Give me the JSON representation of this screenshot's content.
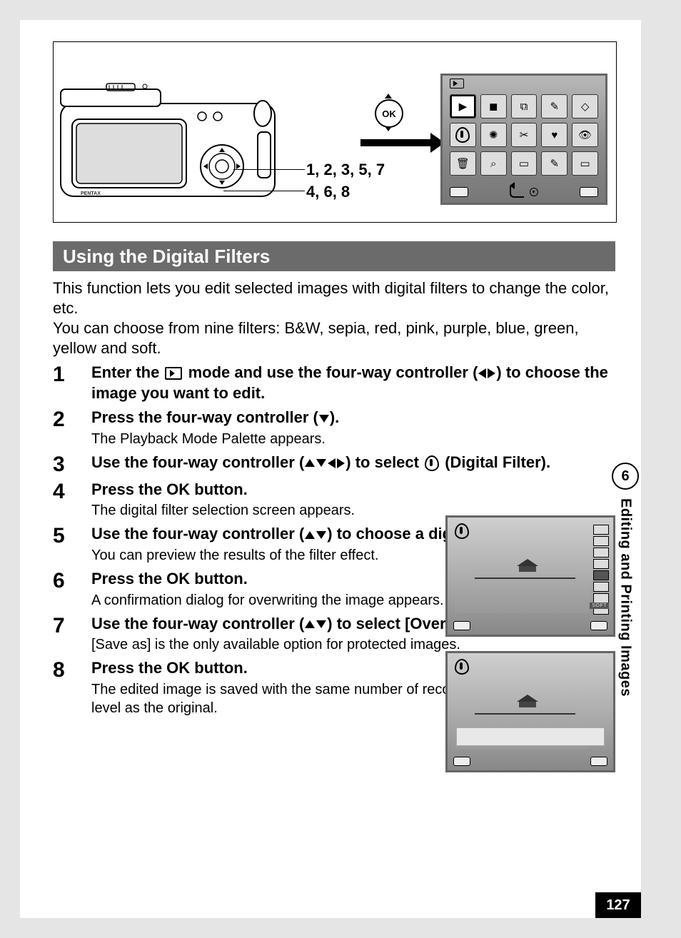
{
  "side": {
    "chapter": "6",
    "label": "Editing and Printing Images"
  },
  "page_number": "127",
  "figure": {
    "ok": "OK",
    "labels_line1": "1, 2, 3, 5, 7",
    "labels_line2": "4, 6, 8"
  },
  "section_title": "Using the Digital Filters",
  "intro_p1": "This function lets you edit selected images with digital filters to change the color, etc.",
  "intro_p2": "You can choose from nine filters: B&W, sepia, red, pink, purple, blue, green, yellow and soft.",
  "steps": {
    "s1": {
      "n": "1",
      "t1": "Enter the ",
      "t2": " mode and use the four-way controller (",
      "t3": ") to choose the image you want to edit."
    },
    "s2": {
      "n": "2",
      "title_a": "Press the four-way controller (",
      "title_b": ").",
      "desc": "The Playback Mode Palette appears."
    },
    "s3": {
      "n": "3",
      "title_a": "Use the four-way controller (",
      "title_b": ") to select ",
      "title_c": " (Digital Filter)."
    },
    "s4": {
      "n": "4",
      "title_a": "Press the ",
      "ok": "OK",
      "title_b": " button.",
      "desc": "The digital filter selection screen appears."
    },
    "s5": {
      "n": "5",
      "title_a": "Use the four-way controller (",
      "title_b": ") to choose a digital filter.",
      "desc": "You can preview the results of the filter effect."
    },
    "s6": {
      "n": "6",
      "title_a": "Press the ",
      "ok": "OK",
      "title_b": " button.",
      "desc": "A confirmation dialog for overwriting the image appears."
    },
    "s7": {
      "n": "7",
      "title_a": "Use the four-way controller (",
      "title_b": ") to select [Overwrite] or [Save as].",
      "desc": "[Save as] is the only available option for protected images."
    },
    "s8": {
      "n": "8",
      "title_a": "Press the ",
      "ok": "OK",
      "title_b": " button.",
      "desc": "The edited image is saved with the same number of recorded pixels and quality level as the original."
    }
  },
  "mini": {
    "soft": "SOFT"
  }
}
